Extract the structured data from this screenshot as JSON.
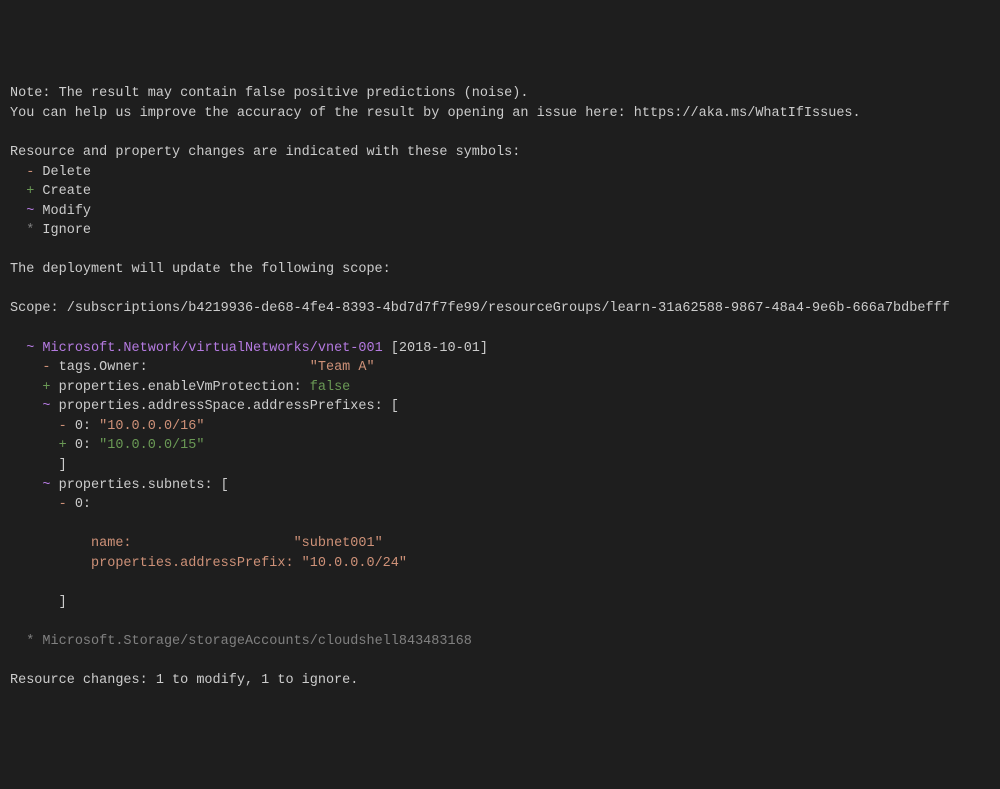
{
  "note": {
    "line1": "Note: The result may contain false positive predictions (noise).",
    "line2": "You can help us improve the accuracy of the result by opening an issue here: https://aka.ms/WhatIfIssues."
  },
  "legend": {
    "header": "Resource and property changes are indicated with these symbols:",
    "delete_symbol": "-",
    "delete_label": "Delete",
    "create_symbol": "+",
    "create_label": "Create",
    "modify_symbol": "~",
    "modify_label": "Modify",
    "ignore_symbol": "*",
    "ignore_label": "Ignore"
  },
  "deployment": {
    "header": "The deployment will update the following scope:",
    "scope_label": "Scope:",
    "scope_value": "/subscriptions/b4219936-de68-4fe4-8393-4bd7d7f7fe99/resourceGroups/learn-31a62588-9867-48a4-9e6b-666a7bdbefff"
  },
  "resource1": {
    "modify_symbol": "~",
    "name": "Microsoft.Network/virtualNetworks/vnet-001",
    "api_version": "[2018-10-01]",
    "tags_owner": {
      "symbol": "-",
      "key": "tags.Owner:",
      "value": "\"Team A\""
    },
    "enable_vm": {
      "symbol": "+",
      "key": "properties.enableVmProtection:",
      "value": "false"
    },
    "address_prefixes": {
      "symbol": "~",
      "key": "properties.addressSpace.addressPrefixes:",
      "bracket_open": "[",
      "old_symbol": "-",
      "old_key": "0:",
      "old_value": "\"10.0.0.0/16\"",
      "new_symbol": "+",
      "new_key": "0:",
      "new_value": "\"10.0.0.0/15\"",
      "bracket_close": "]"
    },
    "subnets": {
      "symbol": "~",
      "key": "properties.subnets:",
      "bracket_open": "[",
      "delete_symbol": "-",
      "index": "0:",
      "name_key": "name:",
      "name_value": "\"subnet001\"",
      "prefix_key": "properties.addressPrefix:",
      "prefix_value": "\"10.0.0.0/24\"",
      "bracket_close": "]"
    }
  },
  "resource2": {
    "symbol": "*",
    "name": "Microsoft.Storage/storageAccounts/cloudshell843483168"
  },
  "summary": "Resource changes: 1 to modify, 1 to ignore."
}
